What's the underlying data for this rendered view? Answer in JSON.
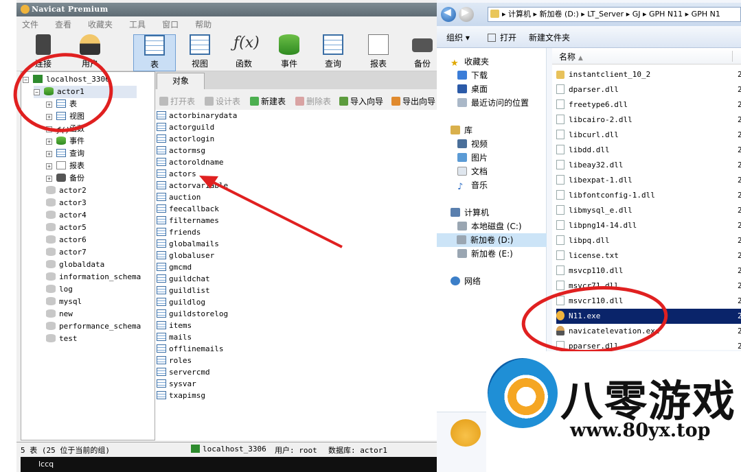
{
  "navicat": {
    "title": "Navicat Premium",
    "menu": [
      "文件",
      "查看",
      "收藏夹",
      "工具",
      "窗口",
      "帮助"
    ],
    "toolbar": {
      "connect": "连接",
      "user": "用户",
      "table": "表",
      "view": "视图",
      "function": "函数",
      "event": "事件",
      "query": "查询",
      "report": "报表",
      "backup": "备份"
    },
    "tree": {
      "server": "localhost_3306",
      "selected_db": "actor1",
      "children": [
        "表",
        "视图",
        "函数",
        "事件",
        "查询",
        "报表",
        "备份"
      ],
      "databases": [
        "actor2",
        "actor3",
        "actor4",
        "actor5",
        "actor6",
        "actor7",
        "globaldata",
        "information_schema",
        "log",
        "mysql",
        "new",
        "performance_schema",
        "test"
      ]
    },
    "tab_label": "对象",
    "objbar": {
      "open_table": "打开表",
      "design_table": "设计表",
      "new_table": "新建表",
      "delete_table": "删除表",
      "import_wizard": "导入向导",
      "export_wizard": "导出向导"
    },
    "tables": [
      "actorbinarydata",
      "actorguild",
      "actorlogin",
      "actormsg",
      "actoroldname",
      "actors",
      "actorvariable",
      "auction",
      "feecallback",
      "filternames",
      "friends",
      "globalmails",
      "globaluser",
      "gmcmd",
      "guildchat",
      "guildlist",
      "guildlog",
      "guildstorelog",
      "items",
      "mails",
      "offlinemails",
      "roles",
      "servercmd",
      "sysvar",
      "txapimsg"
    ],
    "status": {
      "count": "5 表 (25 位于当前的组)",
      "connection": "localhost_3306",
      "user": "用户: root",
      "database": "数据库: actor1"
    },
    "taskbar_text": "lccq"
  },
  "explorer": {
    "address": "▸ 计算机 ▸ 新加卷 (D:) ▸ LT_Server ▸ GJ ▸ GPH N11 ▸ GPH N1",
    "commands": {
      "organize": "组织 ▾",
      "open": "打开",
      "new_folder": "新建文件夹"
    },
    "nav": {
      "favorites": "收藏夹",
      "downloads": "下载",
      "desktop": "桌面",
      "recent": "最近访问的位置",
      "libraries": "库",
      "videos": "视频",
      "pictures": "图片",
      "documents": "文档",
      "music": "音乐",
      "computer": "计算机",
      "local_disk": "本地磁盘 (C:)",
      "new_vol_d": "新加卷 (D:)",
      "new_vol_e": "新加卷 (E:)",
      "network": "网络"
    },
    "column_name": "名称",
    "files": [
      {
        "name": "instantclient_10_2",
        "kind": "folder"
      },
      {
        "name": "dparser.dll",
        "kind": "dll"
      },
      {
        "name": "freetype6.dll",
        "kind": "dll"
      },
      {
        "name": "libcairo-2.dll",
        "kind": "dll"
      },
      {
        "name": "libcurl.dll",
        "kind": "dll"
      },
      {
        "name": "libdd.dll",
        "kind": "dll"
      },
      {
        "name": "libeay32.dll",
        "kind": "dll"
      },
      {
        "name": "libexpat-1.dll",
        "kind": "dll"
      },
      {
        "name": "libfontconfig-1.dll",
        "kind": "dll"
      },
      {
        "name": "libmysql_e.dll",
        "kind": "dll"
      },
      {
        "name": "libpng14-14.dll",
        "kind": "dll"
      },
      {
        "name": "libpq.dll",
        "kind": "dll"
      },
      {
        "name": "license.txt",
        "kind": "txt"
      },
      {
        "name": "msvcp110.dll",
        "kind": "dll"
      },
      {
        "name": "msvcr71.dll",
        "kind": "dll"
      },
      {
        "name": "msvcr110.dll",
        "kind": "dll"
      },
      {
        "name": "N11.exe",
        "kind": "exe"
      },
      {
        "name": "navicatelevation.exe",
        "kind": "person"
      },
      {
        "name": "pparser.dll",
        "kind": "dll"
      }
    ],
    "date_prefix": "2"
  },
  "watermark": {
    "title": "八零游戏",
    "url": "www.80yx.top"
  },
  "annotations": {
    "circle_color": "#e02020",
    "arrow_color": "#e02020"
  }
}
